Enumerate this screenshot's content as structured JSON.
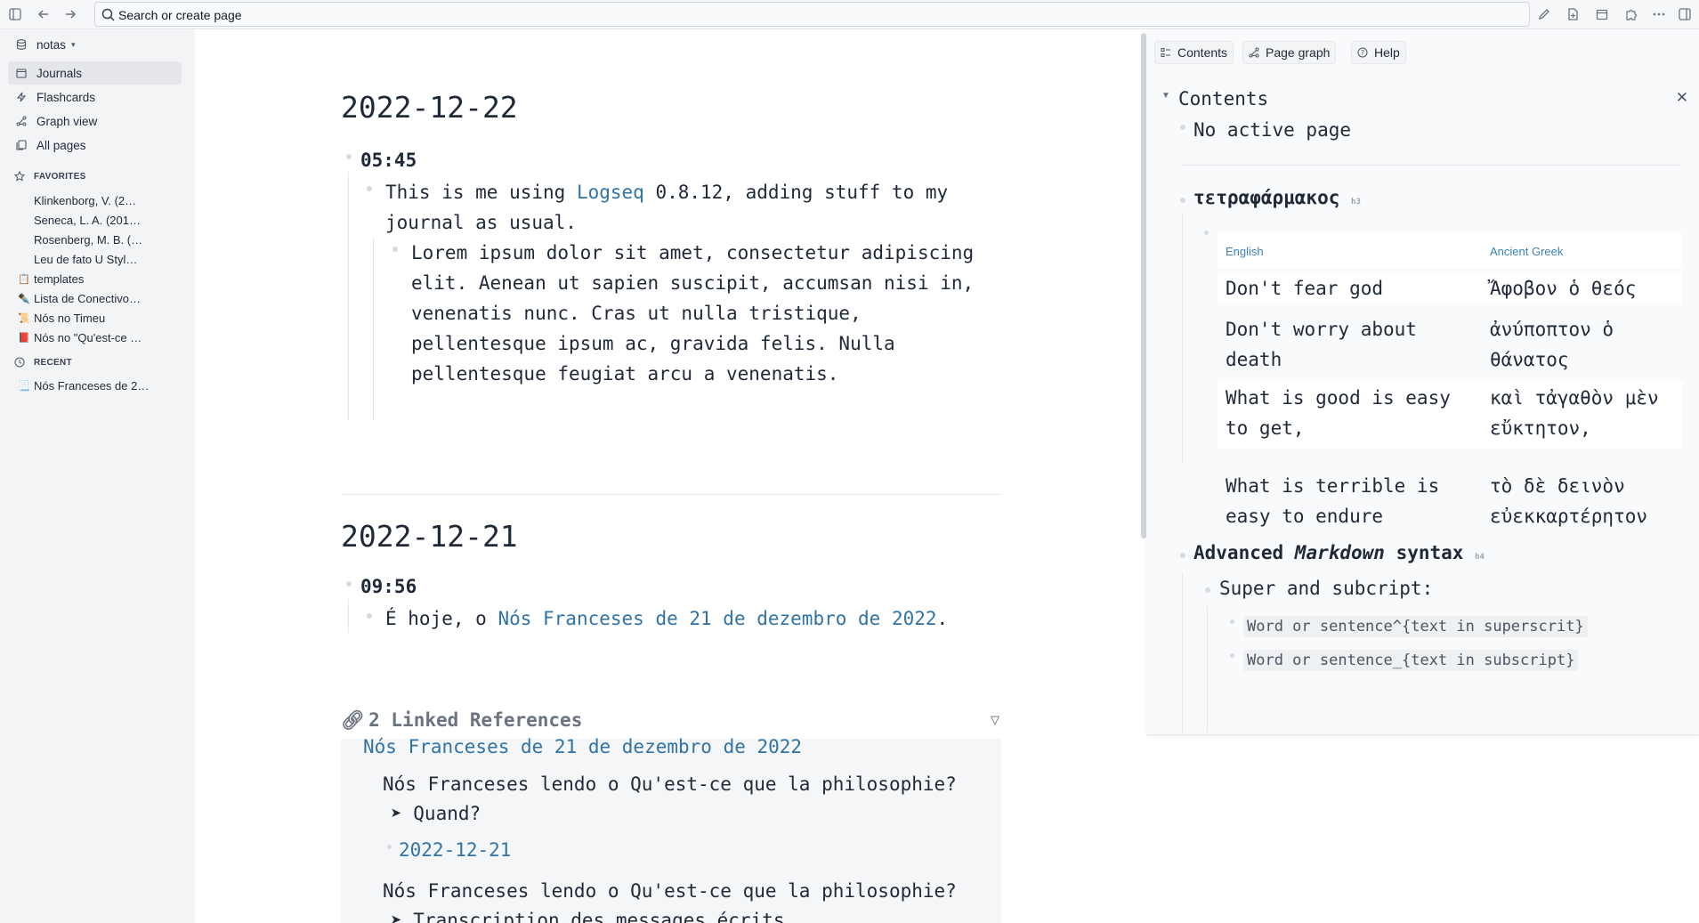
{
  "topbar": {
    "search_placeholder": "Search or create page",
    "icons": [
      "sidebar-toggle-icon",
      "back-arrow-icon",
      "forward-arrow-icon",
      "search-icon",
      "edit-icon",
      "new-page-icon",
      "calendar-icon",
      "puzzle-icon",
      "more-icon",
      "right-sidebar-icon"
    ]
  },
  "sidebar": {
    "graph_name": "notas",
    "nav": [
      {
        "label": "Journals",
        "icon": "calendar-icon"
      },
      {
        "label": "Flashcards",
        "icon": "bolt-icon"
      },
      {
        "label": "Graph view",
        "icon": "graph-icon"
      },
      {
        "label": "All pages",
        "icon": "pages-icon"
      }
    ],
    "favorites_title": "FAVORITES",
    "favorites": [
      {
        "emoji": "",
        "label": "Klinkenborg, V. (2…"
      },
      {
        "emoji": "",
        "label": "Seneca, L. A. (201…"
      },
      {
        "emoji": "",
        "label": "Rosenberg, M. B. (…"
      },
      {
        "emoji": "",
        "label": "Leu de fato U Styl…"
      },
      {
        "emoji": "📋",
        "label": "templates"
      },
      {
        "emoji": "✒️",
        "label": "Lista de Conectivo…"
      },
      {
        "emoji": "📜",
        "label": "Nós no Timeu"
      },
      {
        "emoji": "📕",
        "label": "Nós no \"Qu'est-ce …"
      }
    ],
    "recent_title": "RECENT",
    "recent": [
      {
        "emoji": "📃",
        "label": "Nós Franceses de 2…"
      }
    ]
  },
  "main": {
    "journal1": {
      "title": "2022-12-22",
      "time": "05:45",
      "line1_pre": "This is me using ",
      "line1_link": "Logseq",
      "line1_post": " 0.8.12, adding stuff to my",
      "line2": "journal as usual.",
      "lorem": [
        "Lorem ipsum dolor sit amet, consectetur adipiscing",
        "elit. Aenean ut sapien suscipit, accumsan nisi in,",
        "venenatis nunc. Cras ut nulla tristique,",
        "pellentesque ipsum ac, gravida felis. Nulla",
        "pellentesque feugiat arcu a venenatis."
      ]
    },
    "journal2": {
      "title": "2022-12-21",
      "time": "09:56",
      "line_pre": "É hoje, o ",
      "line_link": "Nós Franceses de 21 de dezembro de 2022",
      "line_post": "."
    },
    "linked_refs": {
      "title": "2 Linked References",
      "page": "Nós Franceses de 21 de dezembro de 2022",
      "ref1": "Nós Franceses lendo o Qu'est-ce que la philosophie?",
      "ref1_child": "➤ Quand?",
      "ref_date": "2022-12-21",
      "ref2": "Nós Franceses lendo o Qu'est-ce que la philosophie?",
      "ref2_child": "➤ Transcription des messages écrits"
    }
  },
  "rightsidebar": {
    "tabs": [
      {
        "label": "Contents",
        "icon": "contents-icon"
      },
      {
        "label": "Page graph",
        "icon": "graph-icon"
      },
      {
        "label": "Help",
        "icon": "help-icon"
      }
    ],
    "contents_title": "Contents",
    "no_active": "No active page",
    "heading1": "τετραφάρμακος",
    "heading1_tag": "h3",
    "table": {
      "headers": [
        "English",
        "Ancient Greek"
      ],
      "rows": [
        {
          "en": [
            "Don't fear god"
          ],
          "gr": [
            "Ἄφοβον ὁ θεός"
          ]
        },
        {
          "en": [
            "Don't worry about",
            "death"
          ],
          "gr": [
            "ἀνύποπτον ὁ",
            "θάνατος"
          ]
        },
        {
          "en": [
            "What is good is easy",
            "to get,"
          ],
          "gr": [
            "καὶ τἀγαθὸν μὲν",
            "εὔκτητον,"
          ]
        },
        {
          "en": [
            "What is terrible is",
            "easy to endure"
          ],
          "gr": [
            "τὸ δὲ δεινὸν",
            "εὐεκκαρτέρητον"
          ]
        }
      ]
    },
    "heading2_pre": "Advanced ",
    "heading2_em": "Markdown",
    "heading2_post": " syntax",
    "heading2_tag": "h4",
    "subhead": "Super and subcript:",
    "code1": "Word or sentence^{text in superscrit}",
    "code2": "Word or sentence_{text in subscript}"
  }
}
